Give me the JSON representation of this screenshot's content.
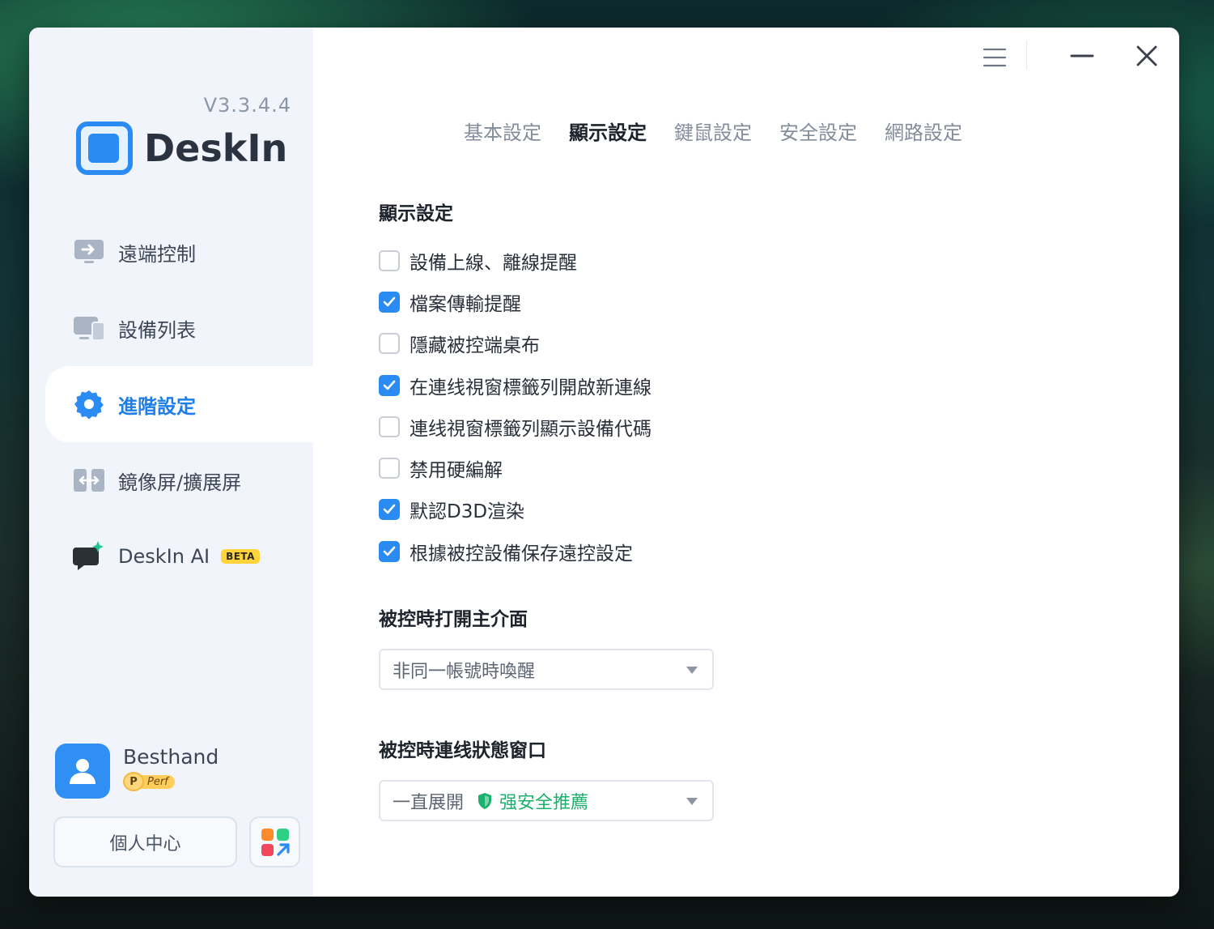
{
  "app": {
    "version": "V3.3.4.4",
    "name": "DeskIn"
  },
  "sidebar": {
    "items": [
      {
        "label": "遠端控制",
        "icon": "remote-control-icon"
      },
      {
        "label": "設備列表",
        "icon": "device-list-icon"
      },
      {
        "label": "進階設定",
        "icon": "gear-icon",
        "active": true
      },
      {
        "label": "鏡像屏/擴展屏",
        "icon": "mirror-screen-icon"
      },
      {
        "label": "DeskIn AI",
        "icon": "ai-chat-icon",
        "badge": "BETA"
      }
    ]
  },
  "user": {
    "name": "Besthand",
    "badge_letter": "P",
    "badge_label": "Perf",
    "personal_center": "個人中心"
  },
  "tabs": [
    "基本設定",
    "顯示設定",
    "鍵鼠設定",
    "安全設定",
    "網路設定"
  ],
  "active_tab": "顯示設定",
  "display_section": {
    "title": "顯示設定",
    "options": [
      {
        "label": "設備上線、離線提醒",
        "checked": false
      },
      {
        "label": "檔案傳輸提醒",
        "checked": true
      },
      {
        "label": "隱藏被控端桌布",
        "checked": false
      },
      {
        "label": "在連线視窗標籤列開啟新連線",
        "checked": true
      },
      {
        "label": "連线視窗標籤列顯示設備代碼",
        "checked": false
      },
      {
        "label": "禁用硬編解",
        "checked": false
      },
      {
        "label": "默認D3D渲染",
        "checked": true
      },
      {
        "label": "根據被控設備保存遠控設定",
        "checked": true
      }
    ]
  },
  "open_main_ui": {
    "title": "被控時打開主介面",
    "selected": "非同一帳號時喚醒"
  },
  "status_window": {
    "title": "被控時連线狀態窗口",
    "selected": "一直展開",
    "tag": "强安全推薦"
  },
  "colors": {
    "accent": "#2a8bf2",
    "sidebar_bg": "#f1f5fb",
    "secure_green": "#1bb06b",
    "beta_yellow": "#ffd43b"
  }
}
